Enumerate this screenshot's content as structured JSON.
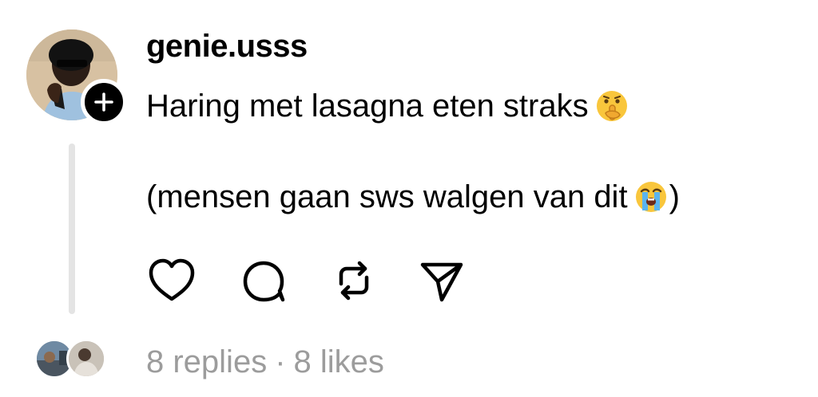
{
  "post": {
    "username": "genie.usss",
    "line1": "Haring met lasagna eten straks",
    "line1_emoji": "shushing-face-emoji",
    "line2_open": "(mensen gaan sws walgen van dit",
    "line2_emoji": "loudly-crying-face-emoji",
    "line2_close": ")"
  },
  "actions": {
    "like_icon": "heart-icon",
    "comment_icon": "comment-bubble-icon",
    "repost_icon": "repost-icon",
    "share_icon": "send-icon"
  },
  "stats": {
    "replies": "8 replies",
    "separator": "·",
    "likes": "8 likes"
  },
  "colors": {
    "text": "#000000",
    "muted": "#9c9c9c",
    "thread_line": "#e4e4e4",
    "background": "#ffffff"
  }
}
